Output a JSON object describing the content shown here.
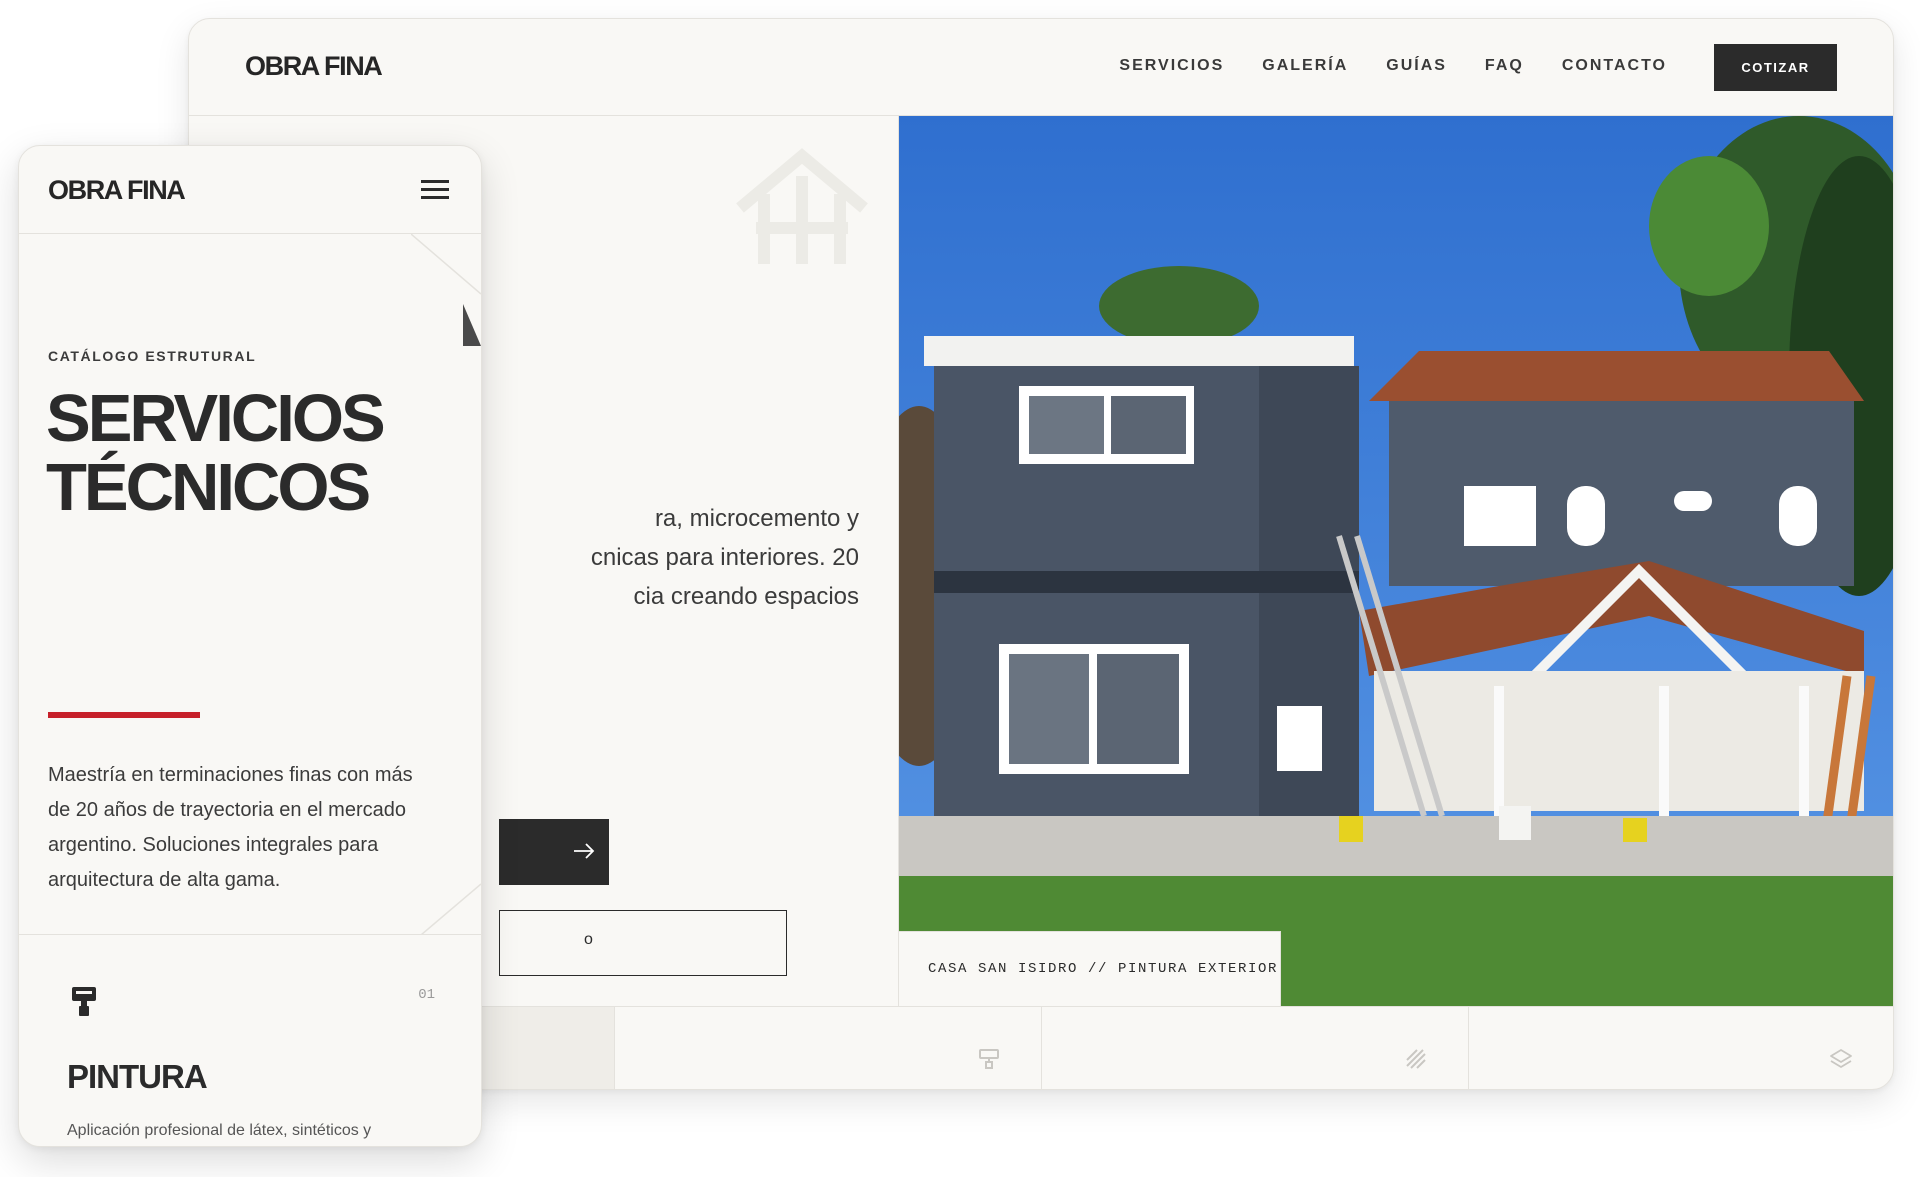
{
  "desktop": {
    "brand": "OBRA FINA",
    "nav": [
      "SERVICIOS",
      "GALERÍA",
      "GUÍAS",
      "FAQ",
      "CONTACTO"
    ],
    "cta": "COTIZAR",
    "hero": {
      "description_lines": [
        "ra, microcemento y",
        "cnicas para interiores. 20",
        "cia creando espacios"
      ],
      "primary_button_icon": "arrow-right-icon",
      "secondary_button_text": "o"
    },
    "caption": "CASA SAN ISIDRO // PINTURA EXTERIOR",
    "strip_icons": [
      "paint-roller-icon",
      "hatch-lines-icon",
      "layers-icon"
    ]
  },
  "mobile": {
    "brand": "OBRA FINA",
    "menu_icon": "hamburger-menu-icon",
    "eyebrow": "CATÁLOGO ESTRUTURAL",
    "title_lines": [
      "SERVICIOS",
      "TÉCNICOS"
    ],
    "body": "Maestría en terminaciones finas con más de 20 años de trayectoria en el mercado argentino. Soluciones integrales para arquitectura de alta gama.",
    "card": {
      "icon": "paint-roller-icon",
      "number": "01",
      "title": "PINTURA",
      "text": "Aplicación profesional de látex, sintéticos y"
    }
  },
  "colors": {
    "background": "#f9f8f5",
    "ink": "#2b2b2b",
    "accent_red": "#c6202a",
    "border": "#e4e2dd",
    "sky_blue": "#2f74d0",
    "facade_slate": "#4a5566",
    "roof_terracotta": "#9a4f30"
  }
}
